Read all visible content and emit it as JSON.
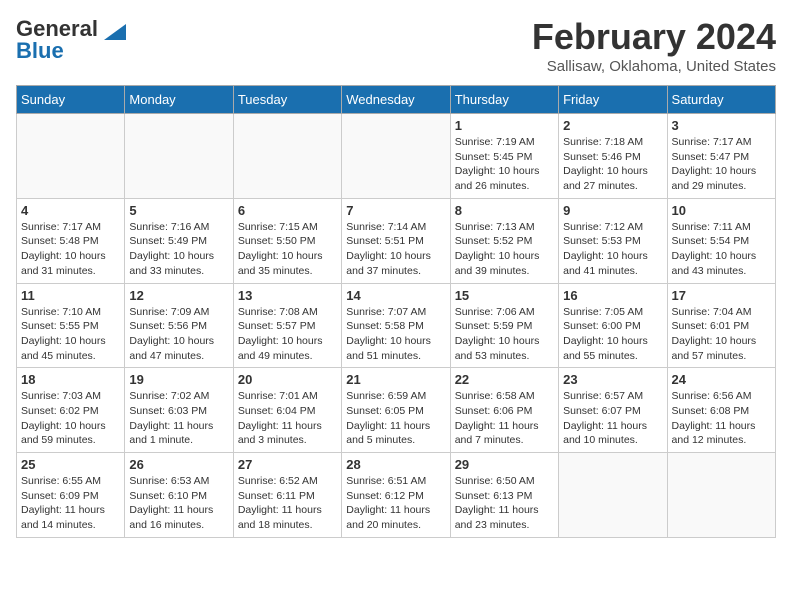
{
  "header": {
    "logo_line1": "General",
    "logo_line2": "Blue",
    "month_title": "February 2024",
    "location": "Sallisaw, Oklahoma, United States"
  },
  "weekdays": [
    "Sunday",
    "Monday",
    "Tuesday",
    "Wednesday",
    "Thursday",
    "Friday",
    "Saturday"
  ],
  "weeks": [
    [
      {
        "day": "",
        "info": ""
      },
      {
        "day": "",
        "info": ""
      },
      {
        "day": "",
        "info": ""
      },
      {
        "day": "",
        "info": ""
      },
      {
        "day": "1",
        "info": "Sunrise: 7:19 AM\nSunset: 5:45 PM\nDaylight: 10 hours\nand 26 minutes."
      },
      {
        "day": "2",
        "info": "Sunrise: 7:18 AM\nSunset: 5:46 PM\nDaylight: 10 hours\nand 27 minutes."
      },
      {
        "day": "3",
        "info": "Sunrise: 7:17 AM\nSunset: 5:47 PM\nDaylight: 10 hours\nand 29 minutes."
      }
    ],
    [
      {
        "day": "4",
        "info": "Sunrise: 7:17 AM\nSunset: 5:48 PM\nDaylight: 10 hours\nand 31 minutes."
      },
      {
        "day": "5",
        "info": "Sunrise: 7:16 AM\nSunset: 5:49 PM\nDaylight: 10 hours\nand 33 minutes."
      },
      {
        "day": "6",
        "info": "Sunrise: 7:15 AM\nSunset: 5:50 PM\nDaylight: 10 hours\nand 35 minutes."
      },
      {
        "day": "7",
        "info": "Sunrise: 7:14 AM\nSunset: 5:51 PM\nDaylight: 10 hours\nand 37 minutes."
      },
      {
        "day": "8",
        "info": "Sunrise: 7:13 AM\nSunset: 5:52 PM\nDaylight: 10 hours\nand 39 minutes."
      },
      {
        "day": "9",
        "info": "Sunrise: 7:12 AM\nSunset: 5:53 PM\nDaylight: 10 hours\nand 41 minutes."
      },
      {
        "day": "10",
        "info": "Sunrise: 7:11 AM\nSunset: 5:54 PM\nDaylight: 10 hours\nand 43 minutes."
      }
    ],
    [
      {
        "day": "11",
        "info": "Sunrise: 7:10 AM\nSunset: 5:55 PM\nDaylight: 10 hours\nand 45 minutes."
      },
      {
        "day": "12",
        "info": "Sunrise: 7:09 AM\nSunset: 5:56 PM\nDaylight: 10 hours\nand 47 minutes."
      },
      {
        "day": "13",
        "info": "Sunrise: 7:08 AM\nSunset: 5:57 PM\nDaylight: 10 hours\nand 49 minutes."
      },
      {
        "day": "14",
        "info": "Sunrise: 7:07 AM\nSunset: 5:58 PM\nDaylight: 10 hours\nand 51 minutes."
      },
      {
        "day": "15",
        "info": "Sunrise: 7:06 AM\nSunset: 5:59 PM\nDaylight: 10 hours\nand 53 minutes."
      },
      {
        "day": "16",
        "info": "Sunrise: 7:05 AM\nSunset: 6:00 PM\nDaylight: 10 hours\nand 55 minutes."
      },
      {
        "day": "17",
        "info": "Sunrise: 7:04 AM\nSunset: 6:01 PM\nDaylight: 10 hours\nand 57 minutes."
      }
    ],
    [
      {
        "day": "18",
        "info": "Sunrise: 7:03 AM\nSunset: 6:02 PM\nDaylight: 10 hours\nand 59 minutes."
      },
      {
        "day": "19",
        "info": "Sunrise: 7:02 AM\nSunset: 6:03 PM\nDaylight: 11 hours\nand 1 minute."
      },
      {
        "day": "20",
        "info": "Sunrise: 7:01 AM\nSunset: 6:04 PM\nDaylight: 11 hours\nand 3 minutes."
      },
      {
        "day": "21",
        "info": "Sunrise: 6:59 AM\nSunset: 6:05 PM\nDaylight: 11 hours\nand 5 minutes."
      },
      {
        "day": "22",
        "info": "Sunrise: 6:58 AM\nSunset: 6:06 PM\nDaylight: 11 hours\nand 7 minutes."
      },
      {
        "day": "23",
        "info": "Sunrise: 6:57 AM\nSunset: 6:07 PM\nDaylight: 11 hours\nand 10 minutes."
      },
      {
        "day": "24",
        "info": "Sunrise: 6:56 AM\nSunset: 6:08 PM\nDaylight: 11 hours\nand 12 minutes."
      }
    ],
    [
      {
        "day": "25",
        "info": "Sunrise: 6:55 AM\nSunset: 6:09 PM\nDaylight: 11 hours\nand 14 minutes."
      },
      {
        "day": "26",
        "info": "Sunrise: 6:53 AM\nSunset: 6:10 PM\nDaylight: 11 hours\nand 16 minutes."
      },
      {
        "day": "27",
        "info": "Sunrise: 6:52 AM\nSunset: 6:11 PM\nDaylight: 11 hours\nand 18 minutes."
      },
      {
        "day": "28",
        "info": "Sunrise: 6:51 AM\nSunset: 6:12 PM\nDaylight: 11 hours\nand 20 minutes."
      },
      {
        "day": "29",
        "info": "Sunrise: 6:50 AM\nSunset: 6:13 PM\nDaylight: 11 hours\nand 23 minutes."
      },
      {
        "day": "",
        "info": ""
      },
      {
        "day": "",
        "info": ""
      }
    ]
  ]
}
